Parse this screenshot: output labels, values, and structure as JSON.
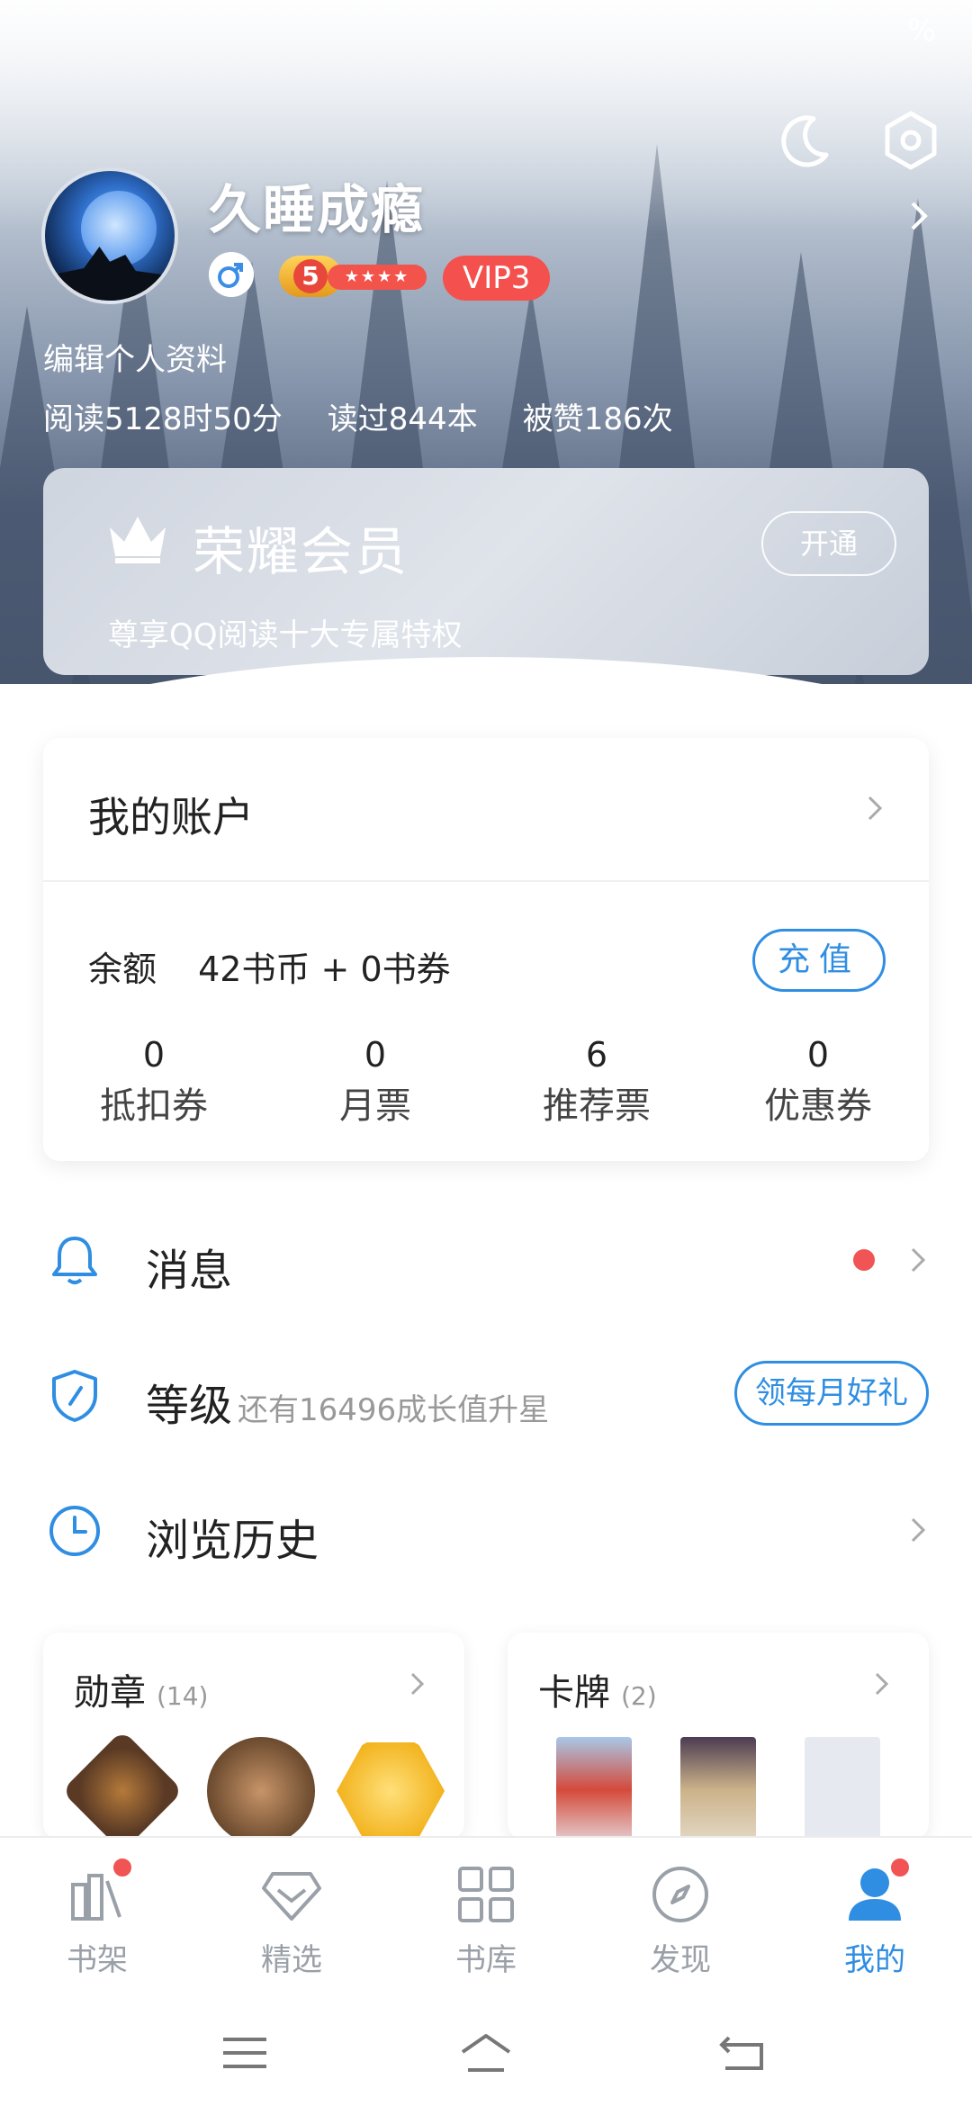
{
  "status_bar": {
    "battery_text": "%"
  },
  "profile": {
    "username": "久睡成瘾",
    "level_number": "5",
    "level_stars": "★★★★",
    "vip_label": "VIP3",
    "edit_label": "编辑个人资料",
    "stats": {
      "read_time": "阅读5128时50分",
      "books_read": "读过844本",
      "likes": "被赞186次"
    }
  },
  "vip_card": {
    "title": "荣耀会员",
    "subtitle": "尊享QQ阅读十大专属特权",
    "open_label": "开通"
  },
  "account": {
    "title": "我的账户",
    "balance_label": "余额",
    "balance_value": "42书币 + 0书券",
    "recharge_label": "充值",
    "tickets": [
      {
        "value": "0",
        "label": "抵扣券"
      },
      {
        "value": "0",
        "label": "月票"
      },
      {
        "value": "6",
        "label": "推荐票"
      },
      {
        "value": "0",
        "label": "优惠券"
      }
    ]
  },
  "menu": {
    "messages": {
      "label": "消息"
    },
    "level": {
      "label": "等级",
      "sub": "还有16496成长值升星",
      "gift_label": "领每月好礼"
    },
    "history": {
      "label": "浏览历史"
    }
  },
  "medals": {
    "title": "勋章",
    "count": "(14)"
  },
  "cards": {
    "title": "卡牌",
    "count": "(2)"
  },
  "tabs": [
    {
      "label": "书架",
      "icon": "bookshelf-icon",
      "badge": true
    },
    {
      "label": "精选",
      "icon": "diamond-icon",
      "badge": false
    },
    {
      "label": "书库",
      "icon": "grid-icon",
      "badge": false
    },
    {
      "label": "发现",
      "icon": "compass-icon",
      "badge": false
    },
    {
      "label": "我的",
      "icon": "user-icon",
      "badge": true,
      "active": true
    }
  ],
  "colors": {
    "accent": "#2f8ee2",
    "vip_red": "#f4504d",
    "badge_red": "#f05454"
  }
}
